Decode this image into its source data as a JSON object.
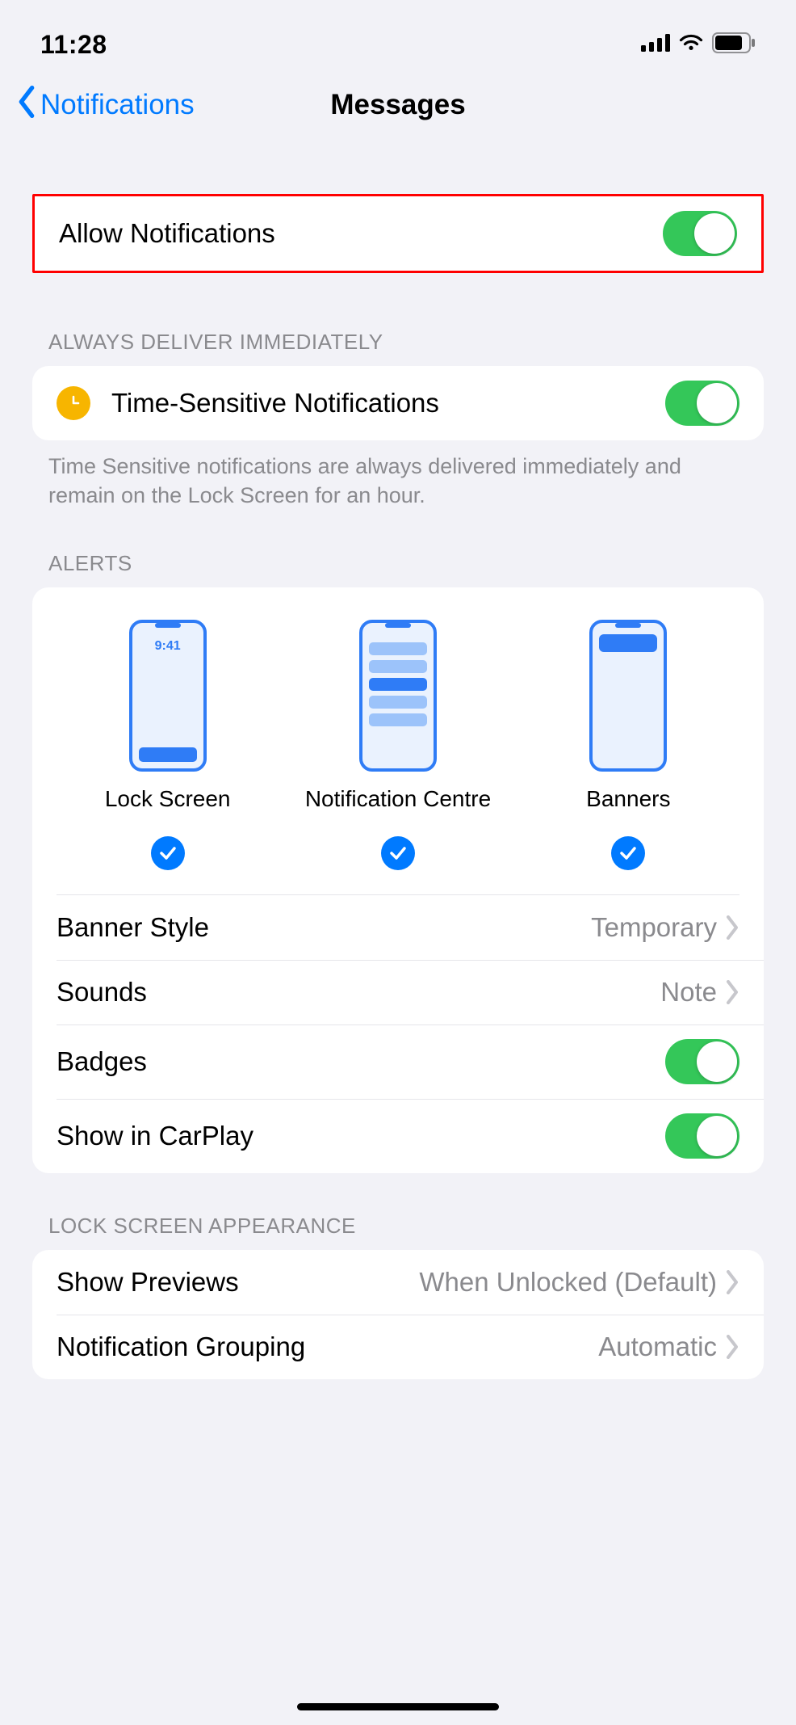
{
  "status": {
    "time": "11:28"
  },
  "nav": {
    "back": "Notifications",
    "title": "Messages"
  },
  "allow": {
    "label": "Allow Notifications",
    "on": true,
    "highlighted": true
  },
  "always": {
    "header": "Always Deliver Immediately",
    "row": {
      "label": "Time-Sensitive Notifications",
      "on": true
    },
    "footer": "Time Sensitive notifications are always delivered immediately and remain on the Lock Screen for an hour."
  },
  "alerts": {
    "header": "Alerts",
    "options": [
      {
        "label": "Lock Screen",
        "checked": true
      },
      {
        "label": "Notification Centre",
        "checked": true
      },
      {
        "label": "Banners",
        "checked": true
      }
    ],
    "previewClock": "9:41",
    "rows": {
      "bannerStyle": {
        "label": "Banner Style",
        "value": "Temporary"
      },
      "sounds": {
        "label": "Sounds",
        "value": "Note"
      },
      "badges": {
        "label": "Badges",
        "on": true
      },
      "carplay": {
        "label": "Show in CarPlay",
        "on": true
      }
    }
  },
  "lockscreen": {
    "header": "Lock Screen Appearance",
    "showPreviews": {
      "label": "Show Previews",
      "value": "When Unlocked (Default)"
    },
    "grouping": {
      "label": "Notification Grouping",
      "value": "Automatic"
    }
  }
}
